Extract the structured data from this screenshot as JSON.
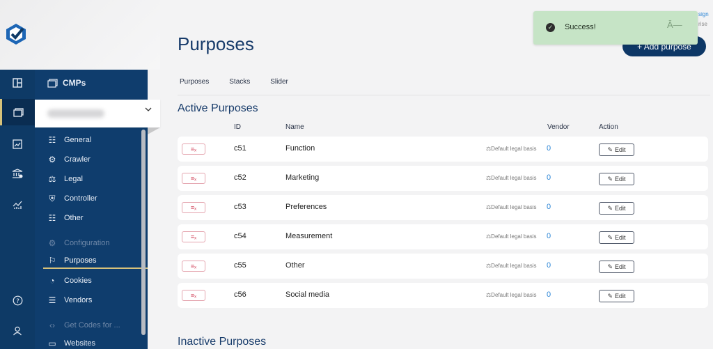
{
  "sidebar": {
    "panel_title": "CMPs",
    "items": [
      {
        "label": "General",
        "icon": "sliders-icon"
      },
      {
        "label": "Crawler",
        "icon": "bug-icon"
      },
      {
        "label": "Legal",
        "icon": "gavel-icon"
      },
      {
        "label": "Controller",
        "icon": "shield-icon"
      },
      {
        "label": "Other",
        "icon": "sliders-icon"
      },
      {
        "label": "Configuration",
        "icon": "gear-icon"
      },
      {
        "label": "Purposes",
        "icon": "flag-icon"
      },
      {
        "label": "Cookies",
        "icon": "cookie-icon"
      },
      {
        "label": "Vendors",
        "icon": "list-icon"
      },
      {
        "label": "Get Codes for ...",
        "icon": "code-icon"
      },
      {
        "label": "Websites",
        "icon": "window-icon"
      }
    ]
  },
  "page": {
    "title": "Purposes",
    "add_button": "+ Add purpose",
    "tabs": [
      "Purposes",
      "Stacks",
      "Slider"
    ],
    "active_section": "Active Purposes",
    "inactive_section": "Inactive Purposes"
  },
  "table": {
    "columns": {
      "id": "ID",
      "name": "Name",
      "vendor": "Vendor",
      "action": "Action"
    },
    "rows": [
      {
        "id": "c51",
        "name": "Function",
        "basis": "Default legal basis",
        "vendor": "0",
        "edit": "Edit"
      },
      {
        "id": "c52",
        "name": "Marketing",
        "basis": "Default legal basis",
        "vendor": "0",
        "edit": "Edit"
      },
      {
        "id": "c53",
        "name": "Preferences",
        "basis": "Default legal basis",
        "vendor": "0",
        "edit": "Edit"
      },
      {
        "id": "c54",
        "name": "Measurement",
        "basis": "Default legal basis",
        "vendor": "0",
        "edit": "Edit"
      },
      {
        "id": "c55",
        "name": "Other",
        "basis": "Default legal basis",
        "vendor": "0",
        "edit": "Edit"
      },
      {
        "id": "c56",
        "name": "Social media",
        "basis": "Default legal basis",
        "vendor": "0",
        "edit": "Edit"
      }
    ]
  },
  "toast": {
    "message": "Success!"
  },
  "corner": {
    "line1": "sign",
    "line2": "rise"
  },
  "colors": {
    "sidebar": "#0f3d6d",
    "accent": "#d7c27a",
    "primary": "#0d3766",
    "toast": "#c6e4c6"
  }
}
